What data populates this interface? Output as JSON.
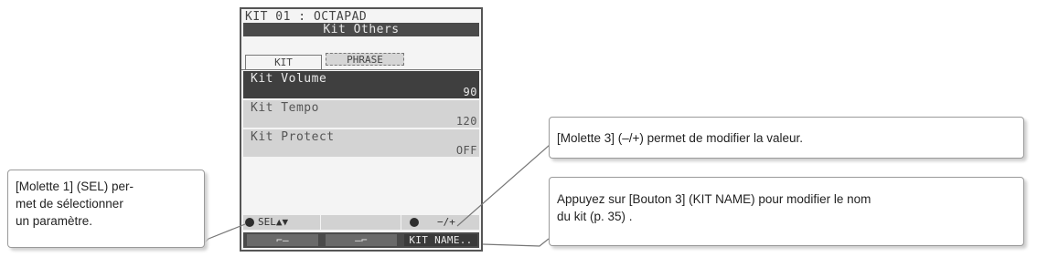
{
  "lcd": {
    "kit_header": "KIT 01 : OCTAPAD",
    "title": "Kit Others",
    "tabs": {
      "kit": "KIT",
      "phrase": "PHRASE"
    },
    "params": [
      {
        "name": "Kit Volume",
        "value": "90"
      },
      {
        "name": "Kit Tempo",
        "value": "120"
      },
      {
        "name": "Kit Protect",
        "value": "OFF"
      }
    ],
    "bottom": {
      "sel_label": "SEL▲▼",
      "value_label": "−/+"
    },
    "func_buttons": {
      "btn1": "⌐–",
      "btn2": "–⌐",
      "btn3": "KIT NAME.."
    }
  },
  "callouts": {
    "molette1": "[Molette 1] (SEL) per- met de sélectionner un paramètre.",
    "molette1_lines": [
      "[Molette 1] (SEL) per-",
      "met de sélectionner",
      "un paramètre."
    ],
    "molette3": "[Molette 3] (–/+) permet de modifier la valeur.",
    "bouton3_lines": [
      "Appuyez sur [Bouton 3] (KIT NAME) pour modifier le nom",
      "du kit (p. 35) ."
    ]
  },
  "colors": {
    "lcd_dark": "#4a4a4a",
    "lcd_light": "#d3d3d3",
    "lcd_bg": "#f4f4f4"
  }
}
